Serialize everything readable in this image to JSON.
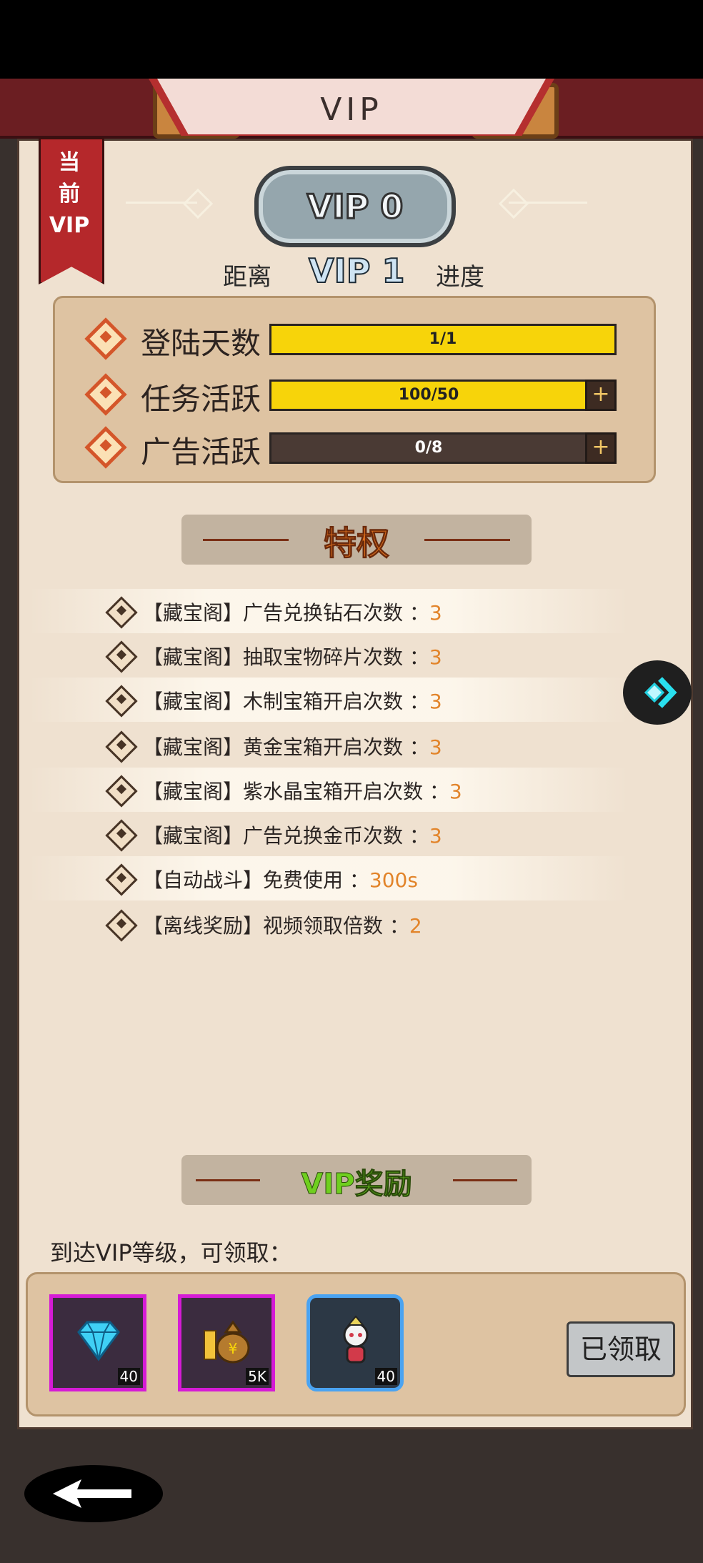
{
  "header": {
    "title": "VIP"
  },
  "ribbon": {
    "lines": [
      "当",
      "前",
      "VIP"
    ]
  },
  "current_vip": {
    "label": "VIP 0"
  },
  "progress": {
    "prefix": "距离",
    "next_level": "VIP 1",
    "suffix": "进度",
    "stats": [
      {
        "label": "登陆天数",
        "text": "1/1",
        "fill_fraction": 1.0,
        "has_plus": false
      },
      {
        "label": "任务活跃",
        "text": "100/50",
        "fill_fraction": 1.0,
        "has_plus": true
      },
      {
        "label": "广告活跃",
        "text": "0/8",
        "fill_fraction": 0.0,
        "has_plus": true
      }
    ]
  },
  "privileges": {
    "title": "特权",
    "items": [
      {
        "label": "【藏宝阁】广告兑换钻石次数 ：",
        "value": "3"
      },
      {
        "label": "【藏宝阁】抽取宝物碎片次数 ：",
        "value": "3"
      },
      {
        "label": "【藏宝阁】木制宝箱开启次数 ：",
        "value": "3"
      },
      {
        "label": "【藏宝阁】黄金宝箱开启次数 ：",
        "value": "3"
      },
      {
        "label": "【藏宝阁】紫水晶宝箱开启次数 ：",
        "value": "3"
      },
      {
        "label": "【藏宝阁】广告兑换金币次数 ：",
        "value": "3"
      },
      {
        "label": "【自动战斗】免费使用 ：",
        "value": "300s"
      },
      {
        "label": "【离线奖励】视频领取倍数 ：",
        "value": "2"
      }
    ]
  },
  "rewards": {
    "title": "VIP奖励",
    "caption": "到达VIP等级，可领取：",
    "items": [
      {
        "icon": "diamond-icon",
        "count": "40"
      },
      {
        "icon": "money-bag-icon",
        "count": "5K"
      },
      {
        "icon": "hero-character-icon",
        "count": "40"
      }
    ],
    "claim_label": "已领取"
  },
  "colors": {
    "bar_fill": "#f7d40a",
    "privilege_title": "#e0711e",
    "reward_title": "#6fcf1f",
    "accent": "#b5282b"
  }
}
